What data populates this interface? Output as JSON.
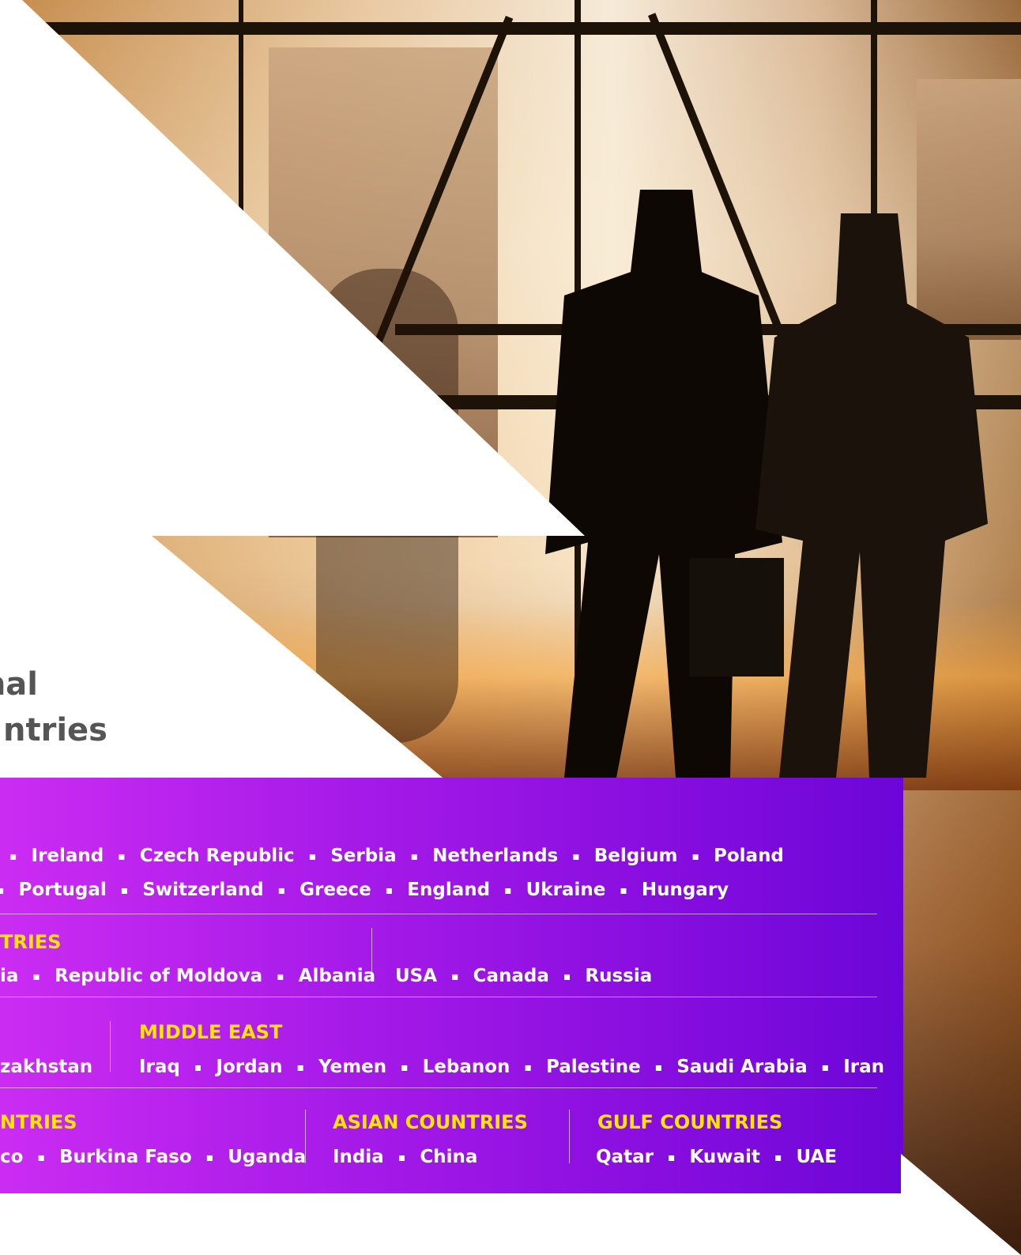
{
  "title": {
    "line1": "nal",
    "line2": "ntries"
  },
  "sections": {
    "europe_row1": [
      "Ireland",
      "Czech Republic",
      "Serbia",
      "Netherlands",
      "Belgium",
      "Poland"
    ],
    "europe_row2": [
      "Portugal",
      "Switzerland",
      "Greece",
      "England",
      "Ukraine",
      "Hungary"
    ],
    "other_eu": {
      "heading": "TRIES",
      "countries": [
        "Republic of Moldova",
        "Albania"
      ],
      "leading_fragment": "ia"
    },
    "americas_russia": {
      "countries": [
        "USA",
        "Canada",
        "Russia"
      ]
    },
    "cis_fragment": {
      "text": "zakhstan"
    },
    "middle_east": {
      "heading": "MIDDLE EAST",
      "countries": [
        "Iraq",
        "Jordan",
        "Yemen",
        "Lebanon",
        "Palestine",
        "Saudi Arabia",
        "Iran"
      ]
    },
    "african": {
      "heading": "NTRIES",
      "leading_fragment": "co",
      "countries": [
        "Burkina Faso",
        "Uganda"
      ]
    },
    "asian": {
      "heading": "ASIAN COUNTRIES",
      "countries": [
        "India",
        "China"
      ]
    },
    "gulf": {
      "heading": "GULF COUNTRIES",
      "countries": [
        "Qatar",
        "Kuwait",
        "UAE"
      ]
    }
  },
  "colors": {
    "heading": "#ffe600",
    "band_start": "#cb2cf2",
    "band_end": "#6c06d8",
    "title": "#555555"
  },
  "separator": "▪"
}
